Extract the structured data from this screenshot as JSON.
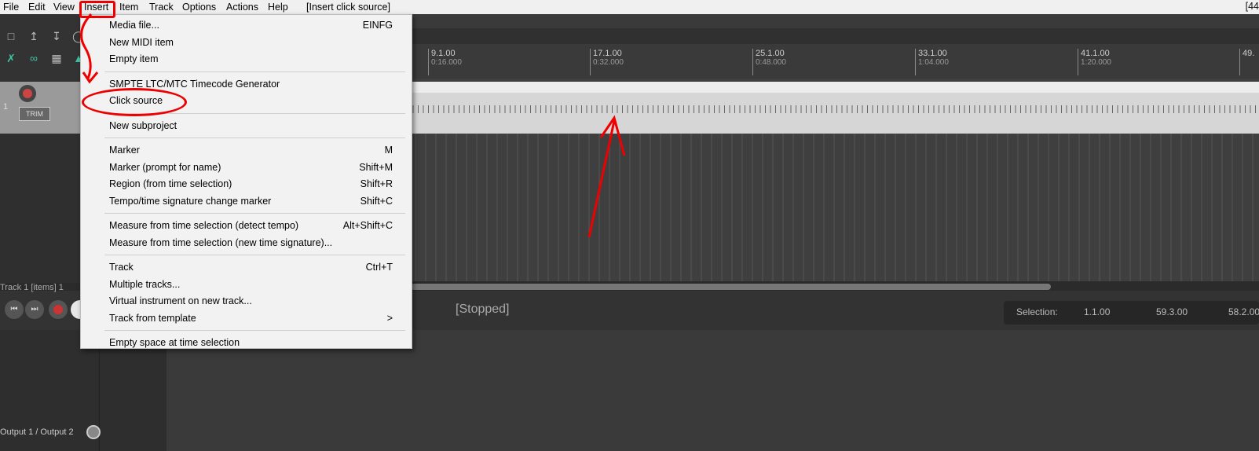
{
  "menubar": {
    "items": [
      "File",
      "Edit",
      "View",
      "Insert",
      "Item",
      "Track",
      "Options",
      "Actions",
      "Help"
    ],
    "hint": "[Insert click source]",
    "right_text": "[44"
  },
  "ruler": {
    "marks": [
      {
        "bar": "9.1.00",
        "time": "0:16.000"
      },
      {
        "bar": "17.1.00",
        "time": "0:32.000"
      },
      {
        "bar": "25.1.00",
        "time": "0:48.000"
      },
      {
        "bar": "33.1.00",
        "time": "1:04.000"
      },
      {
        "bar": "41.1.00",
        "time": "1:20.000"
      },
      {
        "bar": "49."
      }
    ]
  },
  "track": {
    "number": "1",
    "trim_label": "TRIM"
  },
  "transport": {
    "track_info": "Track 1 [items] 1",
    "status": "[Stopped]",
    "selection_label": "Selection:",
    "selection_start": "1.1.00",
    "selection_end": "59.3.00",
    "selection_length": "58.2.00"
  },
  "mixer": {
    "output_label": "Output 1 / Output 2"
  },
  "insert_menu": {
    "groups": [
      [
        {
          "label": "Media file...",
          "shortcut": "EINFG"
        },
        {
          "label": "New MIDI item",
          "shortcut": ""
        },
        {
          "label": "Empty item",
          "shortcut": ""
        }
      ],
      [
        {
          "label": "SMPTE LTC/MTC Timecode Generator",
          "shortcut": ""
        },
        {
          "label": "Click source",
          "shortcut": ""
        }
      ],
      [
        {
          "label": "New subproject",
          "shortcut": ""
        }
      ],
      [
        {
          "label": "Marker",
          "shortcut": "M"
        },
        {
          "label": "Marker (prompt for name)",
          "shortcut": "Shift+M"
        },
        {
          "label": "Region (from time selection)",
          "shortcut": "Shift+R"
        },
        {
          "label": "Tempo/time signature change marker",
          "shortcut": "Shift+C"
        }
      ],
      [
        {
          "label": "Measure from time selection (detect tempo)",
          "shortcut": "Alt+Shift+C"
        },
        {
          "label": "Measure from time selection (new time signature)...",
          "shortcut": ""
        }
      ],
      [
        {
          "label": "Track",
          "shortcut": "Ctrl+T"
        },
        {
          "label": "Multiple tracks...",
          "shortcut": ""
        },
        {
          "label": "Virtual instrument on new track...",
          "shortcut": ""
        },
        {
          "label": "Track from template",
          "shortcut": ">"
        }
      ],
      [
        {
          "label": "Empty space at time selection",
          "shortcut": ""
        }
      ]
    ]
  },
  "colors": {
    "annotation": "#ee0000",
    "menu_bg": "#f2f2f2",
    "accent_green": "#3fc3a3"
  }
}
